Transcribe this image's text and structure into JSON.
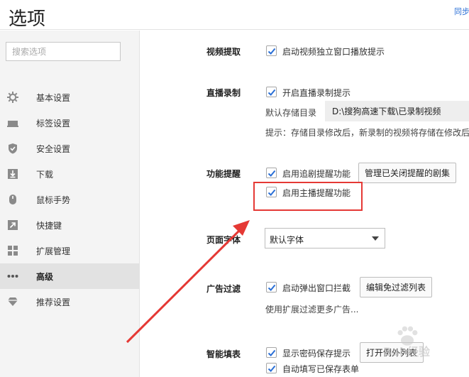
{
  "header": {
    "title": "选项",
    "sync_label": "同步"
  },
  "sidebar": {
    "search_placeholder": "搜索选项",
    "items": [
      {
        "label": "基本设置",
        "icon": "gear-icon"
      },
      {
        "label": "标签设置",
        "icon": "tab-icon"
      },
      {
        "label": "安全设置",
        "icon": "shield-icon"
      },
      {
        "label": "下载",
        "icon": "download-icon"
      },
      {
        "label": "鼠标手势",
        "icon": "mouse-icon"
      },
      {
        "label": "快捷键",
        "icon": "shortcut-icon"
      },
      {
        "label": "扩展管理",
        "icon": "extensions-icon"
      },
      {
        "label": "高级",
        "icon": "more-icon",
        "active": true
      },
      {
        "label": "推荐设置",
        "icon": "diamond-icon"
      }
    ]
  },
  "sections": {
    "video": {
      "label": "视频提取",
      "options": [
        {
          "label": "启动视频独立窗口播放提示",
          "checked": true
        }
      ]
    },
    "live": {
      "label": "直播录制",
      "options": [
        {
          "label": "开启直播录制提示",
          "checked": true
        }
      ],
      "dir_label": "默认存储目录",
      "dir_value": "D:\\搜狗高速下载\\已录制视频",
      "hint": "提示：存储目录修改后，新录制的视频将存储在修改后"
    },
    "reminder": {
      "label": "功能提醒",
      "options": [
        {
          "label": "启用追剧提醒功能",
          "checked": true
        },
        {
          "label": "启用主播提醒功能",
          "checked": true
        }
      ],
      "manage_button": "管理已关闭提醒的剧集"
    },
    "font": {
      "label": "页面字体",
      "select_value": "默认字体"
    },
    "adfilter": {
      "label": "广告过滤",
      "options": [
        {
          "label": "启动弹出窗口拦截",
          "checked": true
        }
      ],
      "edit_button": "编辑免过滤列表",
      "hint": "使用扩展过滤更多广告..."
    },
    "autofill": {
      "label": "智能填表",
      "options": [
        {
          "label": "显示密码保存提示",
          "checked": true
        },
        {
          "label": "自动填写已保存表单",
          "checked": true
        }
      ],
      "exceptions_button": "打开例外列表"
    }
  },
  "annotation": {
    "highlight_color": "#e53935"
  },
  "watermark": {
    "text": "Bai 经验"
  },
  "colors": {
    "accent": "#2a6fd6",
    "checkbox": "#2a6fd6",
    "sidebar_bg": "#f4f4f4",
    "active_bg": "#e2e2e2"
  }
}
